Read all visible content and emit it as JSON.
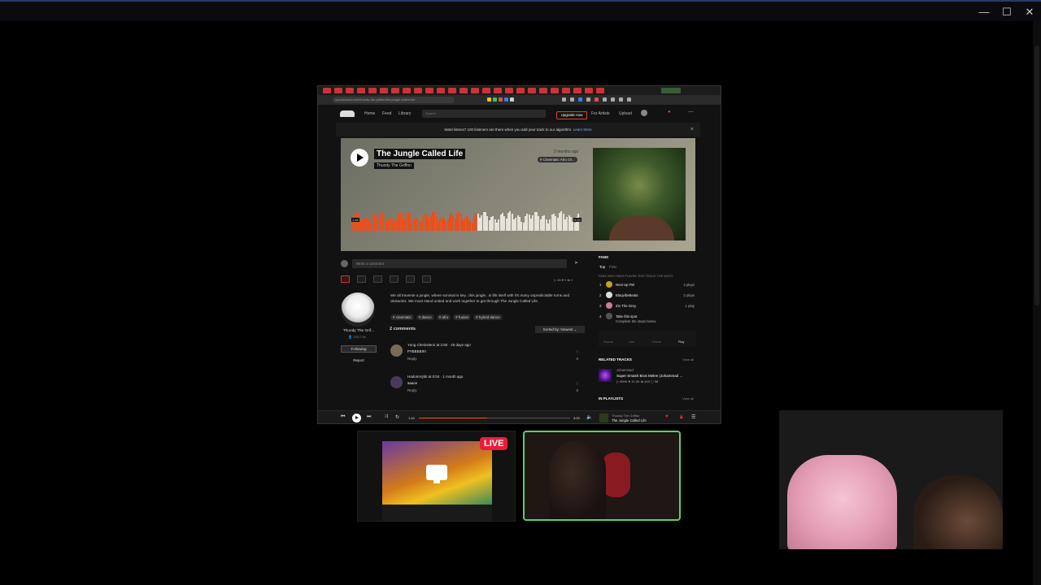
{
  "window": {
    "controls": {
      "minimize": "—",
      "maximize": "☐",
      "close": "✕"
    }
  },
  "browser": {
    "url": "soundcloud.com/thundy-the-griffon/the-jungle-called-life",
    "nav": {
      "home": "Home",
      "feed": "Feed",
      "library": "Library",
      "search_placeholder": "Search",
      "upgrade": "Upgrade now",
      "for_artists": "For Artists",
      "upload": "Upload"
    },
    "banner": {
      "text": "Want listens? 100 listeners are there when you add your track to our algorithm.",
      "learn_more": "Learn More"
    },
    "hero": {
      "title": "The Jungle Called Life",
      "artist": "Thundy The Griffon",
      "posted": "2 months ago",
      "genre": "# Cinematic Afro Or...",
      "time_elapsed": "1:44",
      "time_total": "3:53",
      "waveform_progress": 0.55
    },
    "comment_placeholder": "Write a comment",
    "stats": "▷ 46  ♥ 9  ⇆ 1",
    "profile": {
      "name": "Thundy The Grif...",
      "stats": "👤 176  ≡ 54",
      "following": "Following",
      "report": "Report"
    },
    "description": "We all traverse a jungle, where survival is key...this jungle...is life itself with it's many unpredictable turns and obstacles. We must stand united and work together to get through The Jungle Called Life.",
    "tags": [
      "# cinematic",
      "# dance",
      "# afro",
      "# fusion",
      "# hybrid dance"
    ],
    "comments_count": "2 comments",
    "sort_label": "Sorted by: Newest",
    "comments": [
      {
        "head": "Yung Chelosteroi at 2:50 · 20 days ago",
        "text": "FYEEEE!!!!",
        "reply": "Reply",
        "likes": "0"
      },
      {
        "head": "HadoInVybit at 0:04 · 1 month ago",
        "text": "sauce",
        "reply": "Reply",
        "likes": "0"
      }
    ],
    "right": {
      "fans_title": "FANS",
      "tabs": [
        "Top",
        "First"
      ],
      "fans_sub": "FANS WHO HAVE PLAYED THIS TRACK THE MOST:",
      "fans": [
        {
          "rank": "1",
          "name": "Next Up FM",
          "plays": "4 plays"
        },
        {
          "rank": "2",
          "name": "BlaqvibeBeats",
          "plays": "2 plays"
        },
        {
          "rank": "3",
          "name": "Zin The Grey",
          "plays": "1 play"
        },
        {
          "rank": "4",
          "name": "Take this spot",
          "plays": ""
        }
      ],
      "fan_spot_sub": "Complete the steps below",
      "steps": [
        "Repost",
        "Like",
        "Follow",
        "Play"
      ],
      "related_title": "RELATED TRACKS",
      "view_all": "View all",
      "related": {
        "artist": "Johammad",
        "title": "Super Smash Bros Melee (Johammad ...",
        "stats": "▷ 890K  ♥ 10.2K  ⇆ 393  ▢ 98"
      },
      "playlists_title": "IN PLAYLISTS",
      "playlist_artist": "Next Up FM"
    },
    "player": {
      "elapsed": "1:44",
      "total": "3:53",
      "progress": 0.45,
      "artist": "Thundy The Griffon",
      "title": "The Jungle Called Life"
    }
  },
  "stream": {
    "live_badge": "LIVE"
  }
}
